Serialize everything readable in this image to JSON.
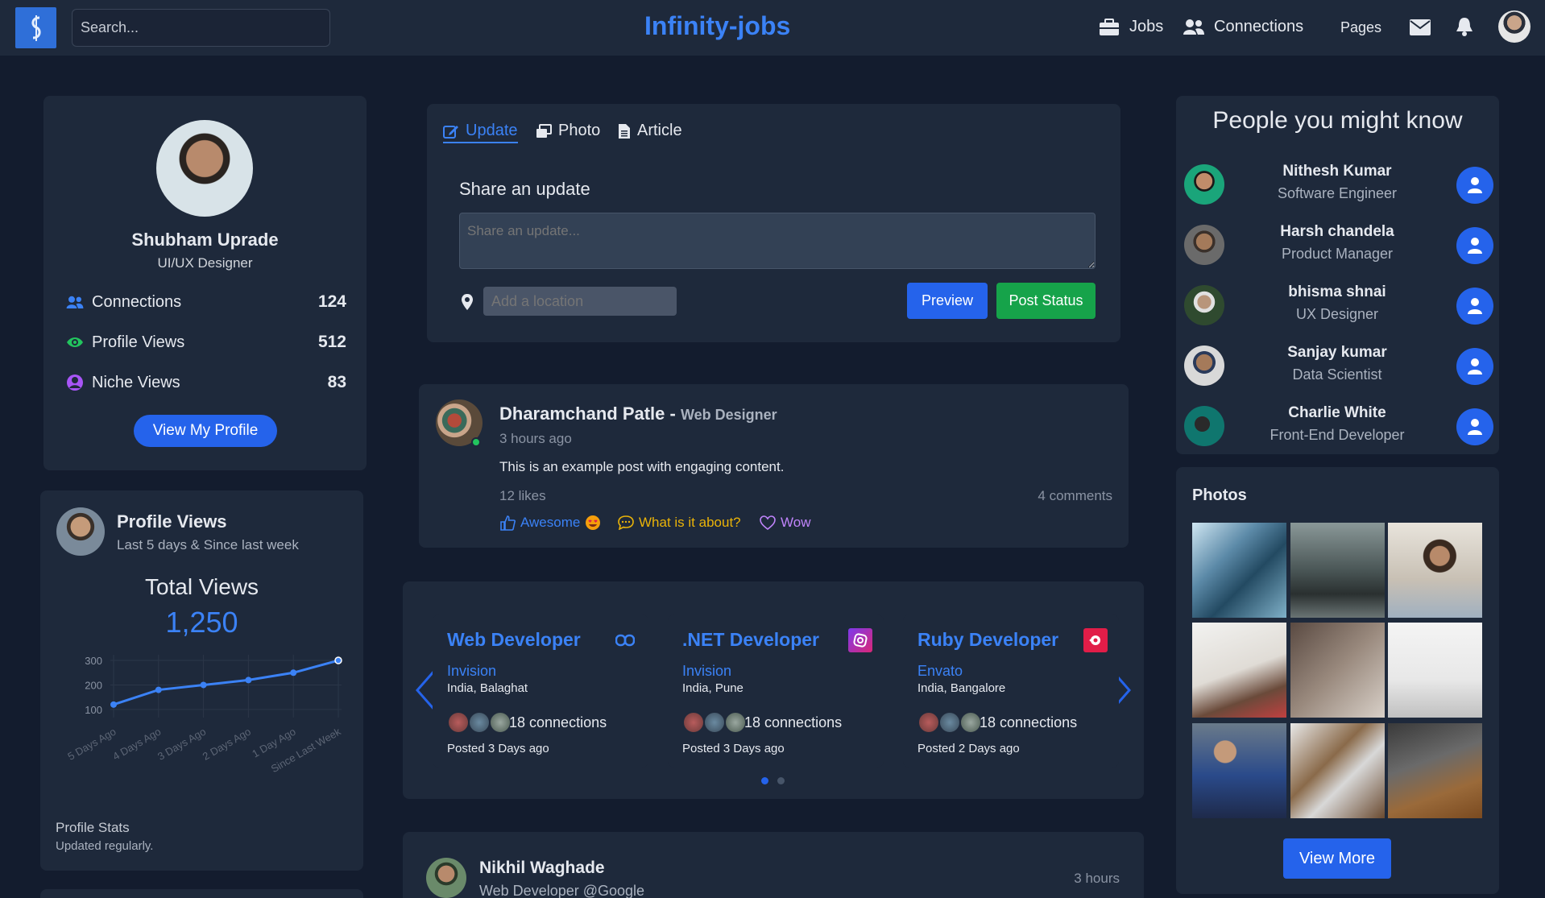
{
  "nav": {
    "search_placeholder": "Search...",
    "brand": "Infinity-jobs",
    "jobs": "Jobs",
    "connections": "Connections",
    "pages": "Pages"
  },
  "profile": {
    "name": "Shubham Uprade",
    "role": "UI/UX Designer",
    "stats": [
      {
        "label": "Connections",
        "value": "124",
        "icon": "users-icon",
        "color": "#3b82f6"
      },
      {
        "label": "Profile Views",
        "value": "512",
        "icon": "eye-icon",
        "color": "#22c55e"
      },
      {
        "label": "Niche Views",
        "value": "83",
        "icon": "user-circle-icon",
        "color": "#a855f7"
      }
    ],
    "button": "View My Profile"
  },
  "views_card": {
    "title": "Profile Views",
    "subtitle": "Last 5 days & Since last week",
    "total_label": "Total Views",
    "total_value": "1,250",
    "footer_title": "Profile Stats",
    "footer_sub": "Updated regularly."
  },
  "chart_data": {
    "type": "line",
    "categories": [
      "5 Days Ago",
      "4 Days Ago",
      "3 Days Ago",
      "2 Days Ago",
      "1 Day Ago",
      "Since Last Week"
    ],
    "values": [
      120,
      180,
      200,
      220,
      250,
      300
    ],
    "yticks": [
      "100",
      "200",
      "300"
    ],
    "ylim": [
      80,
      310
    ],
    "color": "#3b82f6",
    "grid": true
  },
  "composer": {
    "tabs": [
      "Update",
      "Photo",
      "Article"
    ],
    "heading": "Share an update",
    "placeholder": "Share an update...",
    "location_placeholder": "Add a location",
    "preview": "Preview",
    "post": "Post Status"
  },
  "post": {
    "author": "Dharamchand Patle",
    "separator": " - ",
    "author_role": "Web Designer",
    "time": "3 hours ago",
    "text": "This is an example post with engaging content.",
    "likes": "12 likes",
    "comments": "4 comments",
    "actions": [
      "Awesome",
      "What is it about?",
      "Wow"
    ]
  },
  "jobs": [
    {
      "title": "Web Developer",
      "company": "Invision",
      "location": "India, Balaghat",
      "connections": "18 connections",
      "posted": "Posted 3 Days ago",
      "icon": "link-icon",
      "icon_color": "#3b82f6"
    },
    {
      "title": ".NET Developer",
      "company": "Invision",
      "location": "India, Pune",
      "connections": "18 connections",
      "posted": "Posted 3 Days ago",
      "icon": "instagram-icon",
      "icon_color": "#c026d3"
    },
    {
      "title": "Ruby Developer",
      "company": "Envato",
      "location": "India, Bangalore",
      "connections": "18 connections",
      "posted": "Posted 2 Days ago",
      "icon": "record-icon",
      "icon_color": "#e11d48"
    }
  ],
  "post2": {
    "author": "Nikhil Waghade",
    "role": "Web Developer @Google",
    "time": "3 hours"
  },
  "people": {
    "title": "People you might know",
    "list": [
      {
        "name": "Nithesh Kumar",
        "role": "Software Engineer"
      },
      {
        "name": "Harsh chandela",
        "role": "Product Manager"
      },
      {
        "name": "bhisma shnai",
        "role": "UX Designer"
      },
      {
        "name": "Sanjay kumar",
        "role": "Data Scientist"
      },
      {
        "name": "Charlie White",
        "role": "Front-End Developer"
      }
    ]
  },
  "photos": {
    "title": "Photos",
    "button": "View More"
  }
}
